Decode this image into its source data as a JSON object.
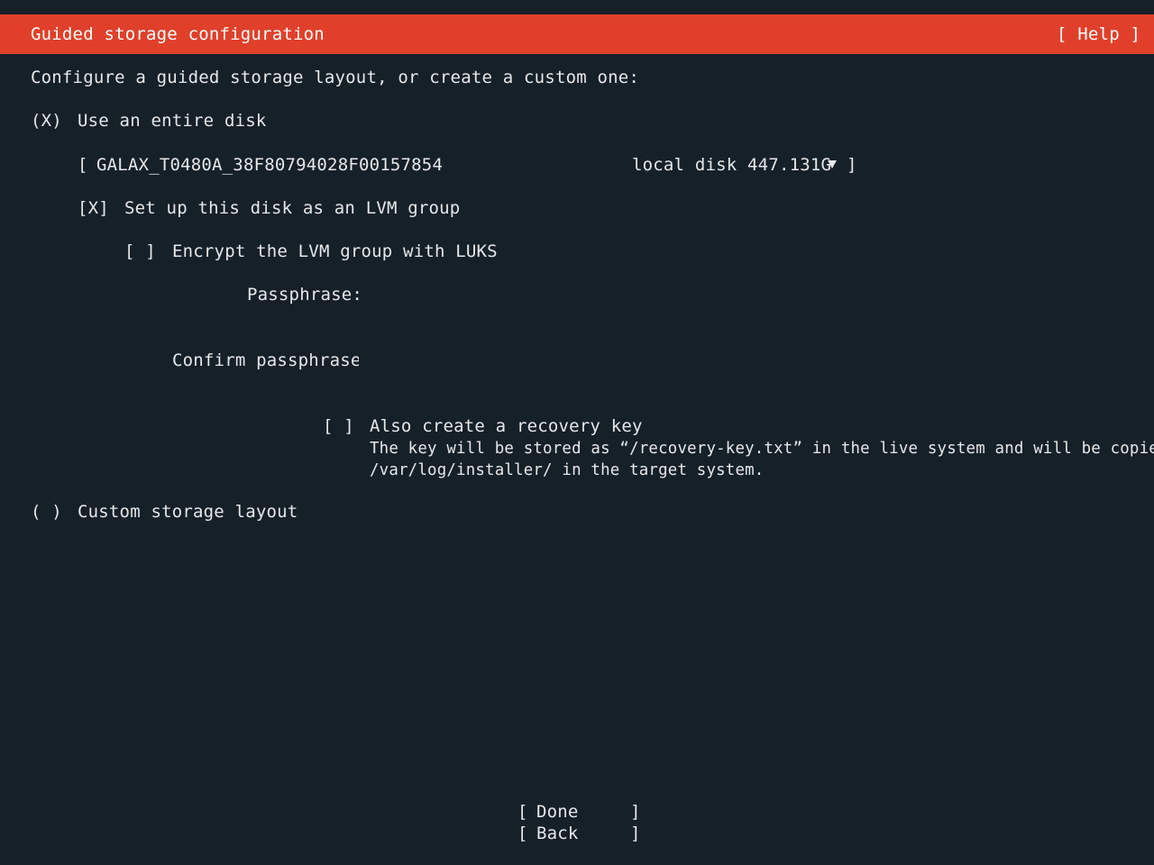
{
  "header": {
    "title": "Guided storage configuration",
    "help_label": "[ Help ]"
  },
  "intro": "Configure a guided storage layout, or create a custom one:",
  "entire_disk": {
    "radio": "(X)",
    "label": "Use an entire disk",
    "disk_select": {
      "open_bracket": "[",
      "name": "GALAX_T0480A_38F80794028F00157854",
      "info": "local disk 447.131G",
      "close_bracket": "]"
    },
    "lvm": {
      "checkbox": "[X]",
      "label": "Set up this disk as an LVM group"
    },
    "luks": {
      "checkbox": "[ ]",
      "label": "Encrypt the LVM group with LUKS"
    },
    "passphrase_label": "Passphrase:",
    "confirm_passphrase_label": "Confirm passphrase:",
    "recovery": {
      "checkbox": "[ ]",
      "label": "Also create a recovery key",
      "help_line1": "The key will be stored as “/recovery-key.txt” in the live system and will be copied to",
      "help_line2": "/var/log/installer/ in the target system."
    }
  },
  "custom_layout": {
    "radio": "( )",
    "label": "Custom storage layout"
  },
  "buttons": {
    "done_label": "Done",
    "back_label": "Back",
    "open_bracket": "[",
    "close_bracket": "]"
  }
}
